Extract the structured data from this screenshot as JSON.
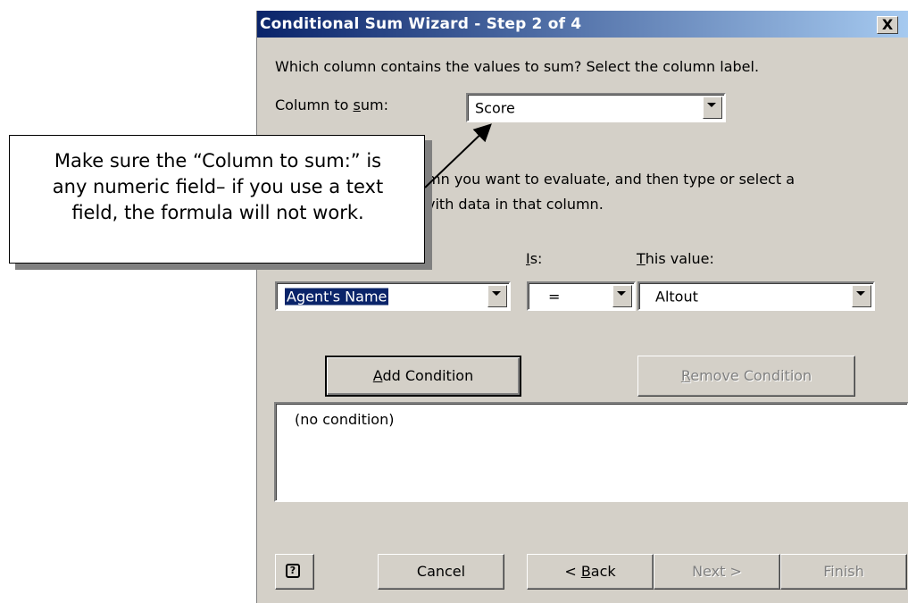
{
  "dialog": {
    "title": "Conditional Sum Wizard - Step 2 of 4",
    "close_label": "X",
    "instruction": "Which column contains the values to sum? Select the column label.",
    "sum_label": "Column to sum:",
    "sum_value": "Score",
    "evaluate_text_1": "mn you want to evaluate, and then type or select a",
    "evaluate_text_2": "vith data in that column.",
    "is_label": "Is:",
    "this_value_label": "This value:",
    "column_value": "Agent's Name",
    "operator_value": "=",
    "this_value": "Altout",
    "add_condition": "Add Condition",
    "remove_condition": "Remove Condition",
    "condition_list": [
      "(no condition)"
    ],
    "help_icon": "help-icon",
    "cancel": "Cancel",
    "back": "< Back",
    "next": "Next >",
    "finish": "Finish"
  },
  "callout": {
    "line1": "Make sure the “Column to sum:” is",
    "line2": "any numeric field– if you use a text",
    "line3": "field, the formula will not work."
  },
  "colors": {
    "titlebar_start": "#0a246a",
    "titlebar_end": "#a6caf0",
    "dialog_bg": "#d4d0c8",
    "selection": "#0a246a"
  }
}
